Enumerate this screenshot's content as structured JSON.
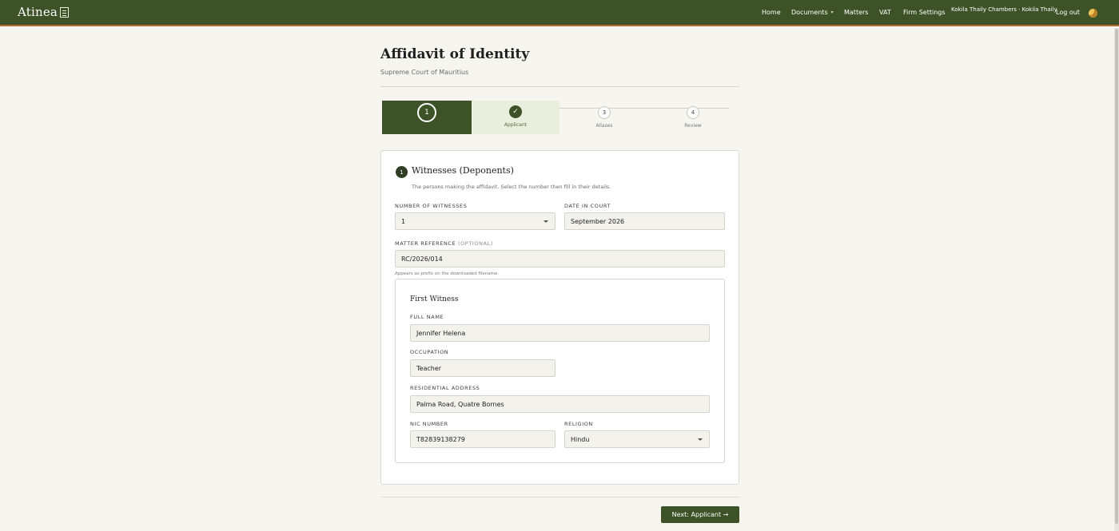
{
  "header": {
    "logo": "Atinea",
    "nav": {
      "home": "Home",
      "documents": "Documents",
      "matters": "Matters",
      "vat": "VAT",
      "firm_settings": "Firm Settings",
      "account": "Kokila Thaily Chambers · Kokila Thaily",
      "logout": "Log out"
    },
    "brand_color": "#3d5227",
    "accent_color": "#b86a2e"
  },
  "page": {
    "title": "Affidavit of Identity",
    "subtitle": "Supreme Court of Mauritius"
  },
  "stepper": {
    "steps": [
      {
        "number": "1",
        "label": "",
        "state": "active"
      },
      {
        "number": "✓",
        "label": "Applicant",
        "state": "done"
      },
      {
        "number": "3",
        "label": "Aliases",
        "state": "pending"
      },
      {
        "number": "4",
        "label": "Review",
        "state": "pending"
      }
    ]
  },
  "section": {
    "number": "1",
    "title": "Witnesses (Deponents)",
    "description": "The persons making the affidavit. Select the number then fill in their details.",
    "witness_count_label": "Number of Witnesses",
    "witness_count_value": "1",
    "date_label": "Date in Court",
    "date_value": "September 2026",
    "matter_label": "Matter Reference",
    "matter_optional": "(Optional)",
    "matter_value": "RC/2026/014",
    "matter_hint": "Appears as prefix on the downloaded filename."
  },
  "witness": {
    "title": "First Witness",
    "full_name_label": "Full Name",
    "full_name_value": "Jennifer Helena",
    "occupation_label": "Occupation",
    "occupation_value": "Teacher",
    "address_label": "Residential Address",
    "address_value": "Palma Road, Quatre Bornes",
    "nic_label": "NIC Number",
    "nic_value": "T82839138279",
    "religion_label": "Religion",
    "religion_value": "Hindu"
  },
  "actions": {
    "next_label": "Next: Applicant →"
  }
}
